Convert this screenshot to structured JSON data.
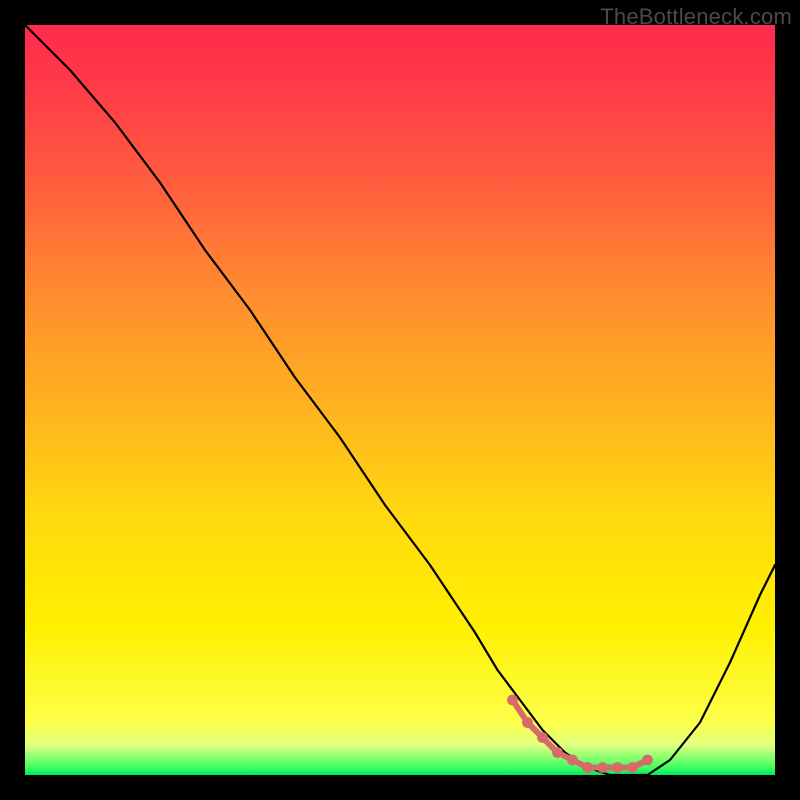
{
  "watermark": "TheBottleneck.com",
  "chart_data": {
    "type": "line",
    "title": "",
    "xlabel": "",
    "ylabel": "",
    "xlim": [
      0,
      100
    ],
    "ylim": [
      0,
      100
    ],
    "series": [
      {
        "name": "curve",
        "x": [
          0,
          6,
          12,
          18,
          24,
          30,
          36,
          42,
          48,
          54,
          60,
          63,
          66,
          69,
          72,
          75,
          78,
          81,
          83,
          86,
          90,
          94,
          98,
          100
        ],
        "values": [
          100,
          94,
          87,
          79,
          70,
          62,
          53,
          45,
          36,
          28,
          19,
          14,
          10,
          6,
          3,
          1,
          0,
          0,
          0,
          2,
          7,
          15,
          24,
          28
        ]
      }
    ],
    "highlight": {
      "name": "flat-segment-dots",
      "x": [
        65,
        67,
        69,
        71,
        73,
        75,
        77,
        79,
        81,
        83
      ],
      "values": [
        10,
        7,
        5,
        3,
        2,
        1,
        1,
        1,
        1,
        2
      ],
      "color": "#d86a6a"
    }
  }
}
